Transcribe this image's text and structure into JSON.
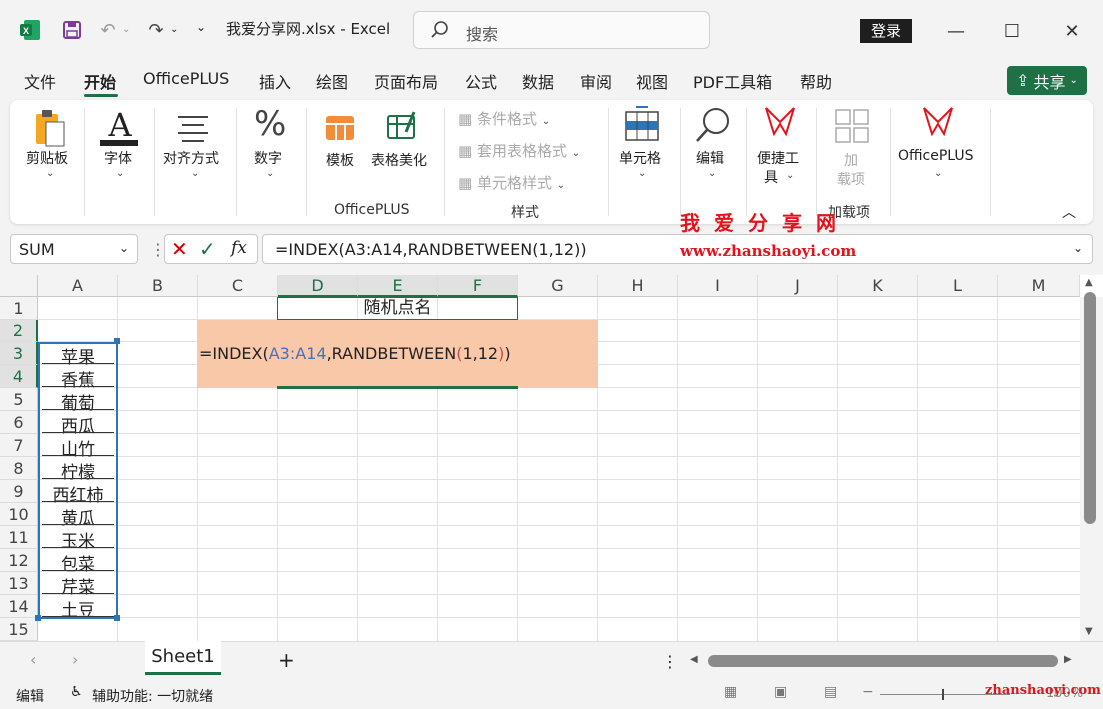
{
  "titlebar": {
    "filename": "我爱分享网.xlsx  -  Excel",
    "search_placeholder": "搜索",
    "login": "登录"
  },
  "tabs": [
    "文件",
    "开始",
    "OfficePLUS",
    "插入",
    "绘图",
    "页面布局",
    "公式",
    "数据",
    "审阅",
    "视图",
    "PDF工具箱",
    "帮助"
  ],
  "share": "共享",
  "ribbon": {
    "clipboard": "剪贴板",
    "font": "字体",
    "align": "对齐方式",
    "number": "数字",
    "template": "模板",
    "beautify": "表格美化",
    "group_officeplus": "OfficePLUS",
    "cond_format": "条件格式",
    "table_format": "套用表格格式",
    "cell_style": "单元格样式",
    "group_style": "样式",
    "cells": "单元格",
    "edit": "编辑",
    "tools_1": "便捷工",
    "tools_2": "具",
    "addin_1": "加",
    "addin_2": "载项",
    "group_addin": "加载项",
    "officeplus_btn": "OfficePLUS"
  },
  "formula_bar": {
    "name_box": "SUM",
    "fx": "fx",
    "formula": "=INDEX(A3:A14,RANDBETWEEN(1,12))"
  },
  "watermark": {
    "cn": "我爱分享网",
    "url": "www.zhanshaoyi.com",
    "url_status": "zhanshaoyi.com"
  },
  "columns": [
    "A",
    "B",
    "C",
    "D",
    "E",
    "F",
    "G",
    "H",
    "I",
    "J",
    "K",
    "L",
    "M"
  ],
  "rows": [
    "1",
    "2",
    "3",
    "4",
    "5",
    "6",
    "7",
    "8",
    "9",
    "10",
    "11",
    "12",
    "13",
    "14",
    "15"
  ],
  "cells": {
    "d1": "随机点名",
    "a_values": [
      "苹果",
      "香蕉",
      "葡萄",
      "西瓜",
      "山竹",
      "柠檬",
      "西红柿",
      "黄瓜",
      "玉米",
      "包菜",
      "芹菜",
      "土豆"
    ],
    "edit_prefix": "=INDEX(",
    "edit_ref": "A3:A14",
    "edit_mid": ",RANDBETWEEN",
    "edit_lp": "(",
    "edit_args": "1,12",
    "edit_rp": ")",
    "edit_end": ")"
  },
  "sheet": {
    "name": "Sheet1",
    "add": "+"
  },
  "status": {
    "mode": "编辑",
    "accessibility": "辅助功能: 一切就绪",
    "zoom": "100%"
  }
}
